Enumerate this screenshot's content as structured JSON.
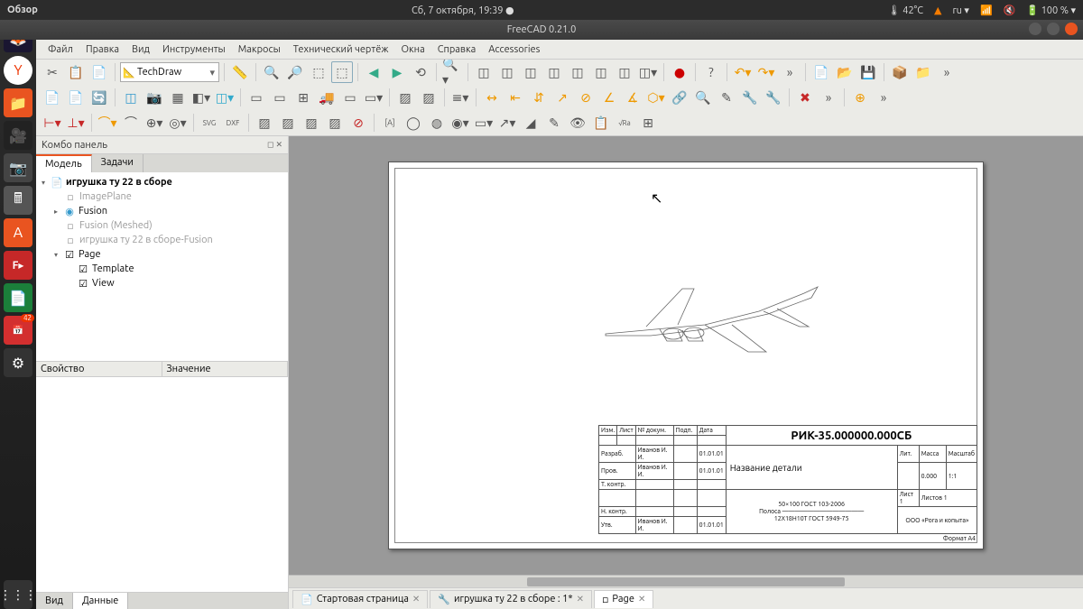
{
  "topbar": {
    "overview": "Обзор",
    "datetime": "Сб, 7 октября, 19:39 ●",
    "temp": "🌡 42°C",
    "lang": "ru ▾",
    "battery": "🔋 100 % ▾"
  },
  "titlebar": {
    "title": "FreeCAD 0.21.0"
  },
  "menubar": {
    "file": "Файл",
    "edit": "Правка",
    "view": "Вид",
    "tools": "Инструменты",
    "macros": "Макросы",
    "techdraw": "Технический чертёж",
    "windows": "Окна",
    "help": "Справка",
    "accessories": "Accessories"
  },
  "workbench": {
    "current": "TechDraw"
  },
  "combo": {
    "title": "Комбо панель",
    "tabs": {
      "model": "Модель",
      "tasks": "Задачи"
    },
    "bottom_tabs": {
      "view": "Вид",
      "data": "Данные"
    },
    "prop_headers": {
      "property": "Свойство",
      "value": "Значение"
    }
  },
  "tree": {
    "doc": "игрушка ту 22 в сборе",
    "items": [
      {
        "label": "ImagePlane",
        "greyed": true,
        "indent": 2
      },
      {
        "label": "Fusion",
        "arrow": "▸",
        "indent": 1
      },
      {
        "label": "Fusion (Meshed)",
        "greyed": true,
        "indent": 2
      },
      {
        "label": "игрушка ту 22 в сборе-Fusion",
        "greyed": true,
        "indent": 2
      },
      {
        "label": "Page",
        "arrow": "▾",
        "indent": 1,
        "check": true
      },
      {
        "label": "Template",
        "indent": 3,
        "check": true
      },
      {
        "label": "View",
        "indent": 3,
        "check": true
      }
    ]
  },
  "doc_tabs": {
    "start": "Стартовая страница",
    "model": "игрушка ту 22 в сборе : 1*",
    "page": "Page"
  },
  "titleblock": {
    "code": "РИК-35.000000.000СБ",
    "partname": "Название детали",
    "lit": "Лит.",
    "mass": "Масса",
    "scale": "Масштаб",
    "mass_val": "0.000",
    "scale_val": "1:1",
    "sheet": "Лист 1",
    "sheets": "Листов 1",
    "company": "ООО «Рога и копыта»",
    "format": "Формат А4",
    "material1": "50×100 ГОСТ 103-2006",
    "material_sep": "Полоса ―――――――――――――",
    "material2": "12Х18Н10Т ГОСТ 5949-75",
    "h_izm": "Изм.",
    "h_list": "Лист",
    "h_docnum": "№ докум.",
    "h_sign": "Подп.",
    "h_date": "Дата",
    "r_razrab": "Разраб.",
    "r_prov": "Пров.",
    "r_tkontr": "Т. контр.",
    "r_nkontr": "Н. контр.",
    "r_utv": "Утв.",
    "name": "Иванов И. И.",
    "date": "01.01.01"
  },
  "dock": {
    "cal_badge": "42"
  }
}
